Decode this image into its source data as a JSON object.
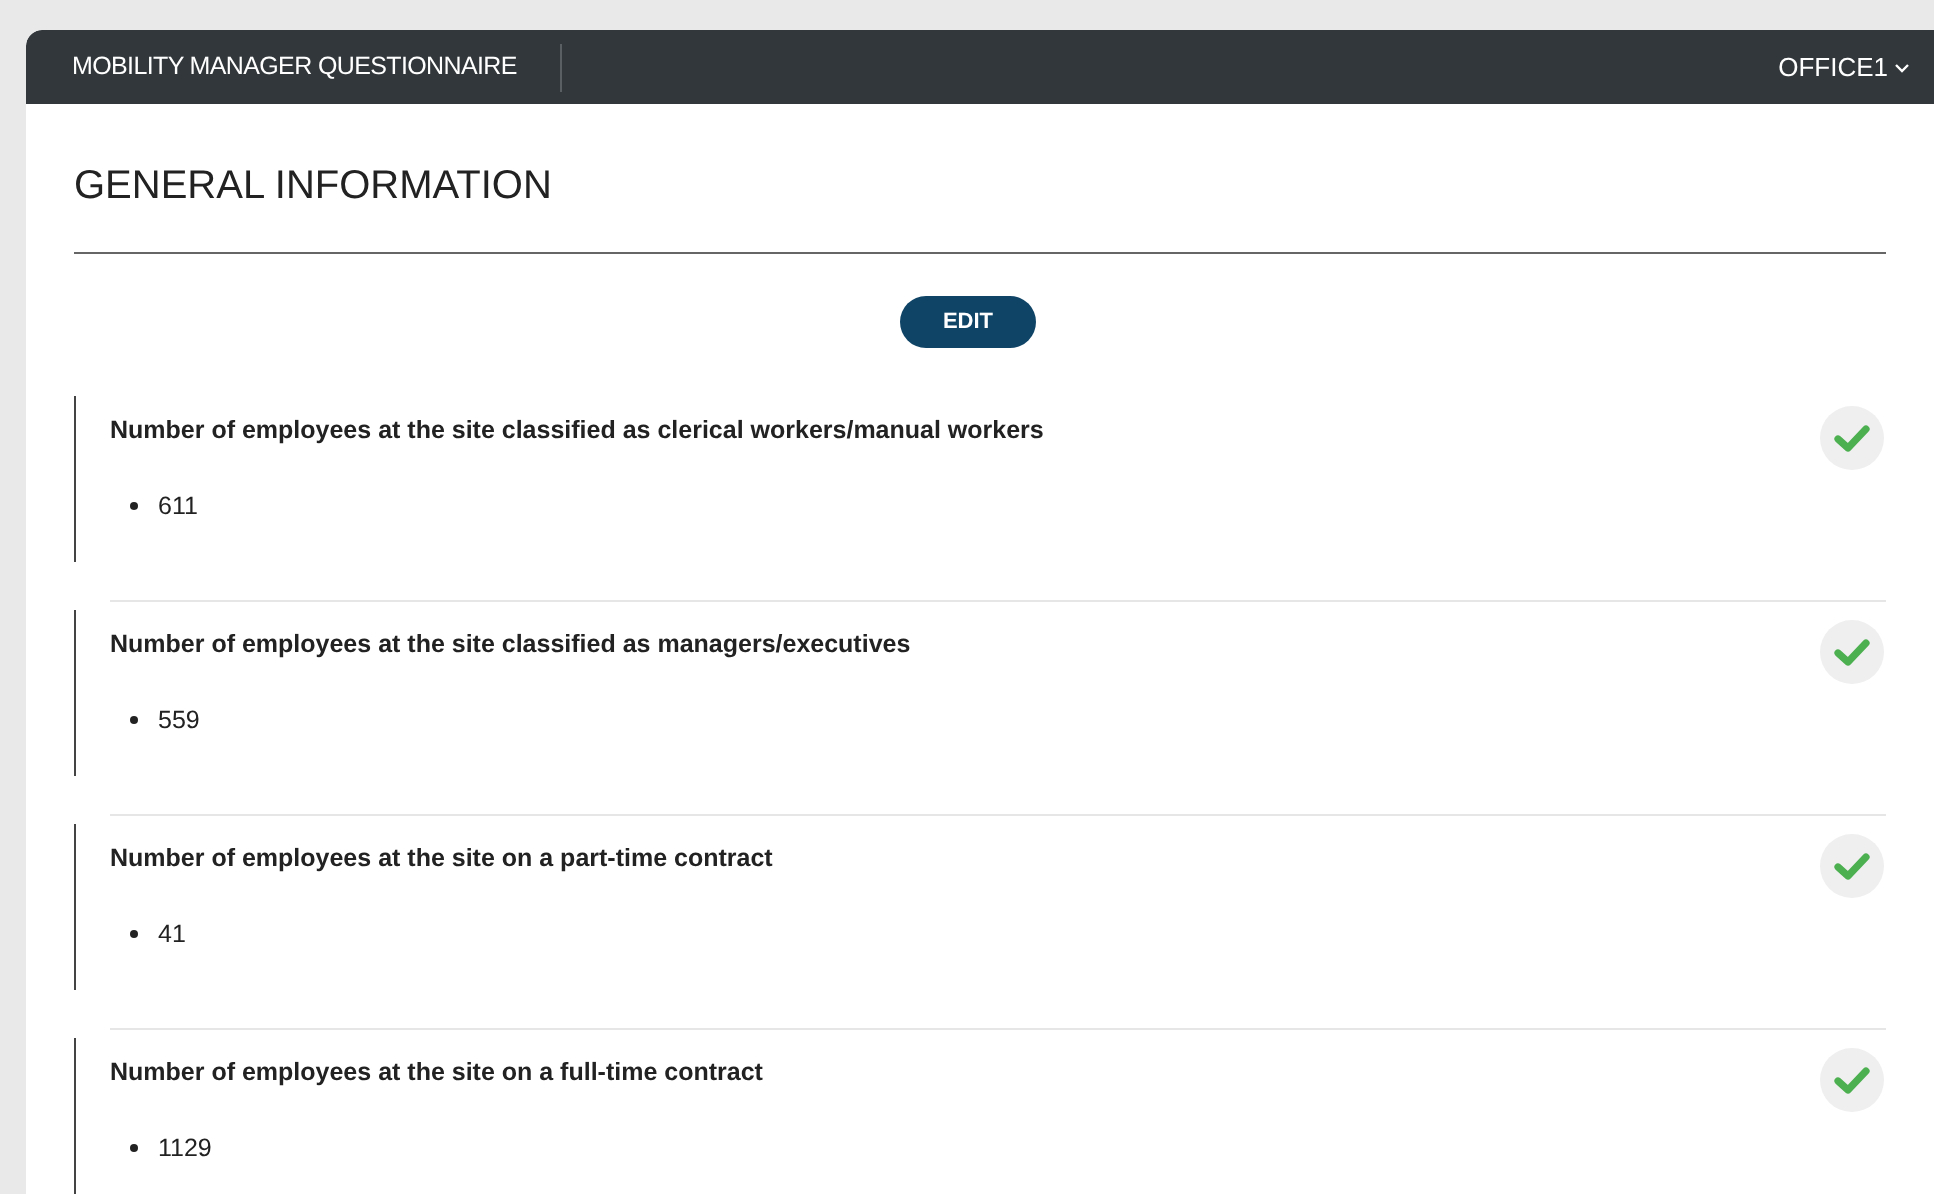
{
  "header": {
    "title": "MOBILITY MANAGER QUESTIONNAIRE",
    "office": "OFFICE1"
  },
  "section": {
    "title": "GENERAL INFORMATION",
    "edit_button": "EDIT"
  },
  "questions": [
    {
      "question": "Number of employees at the site classified as clerical workers/manual workers",
      "answer": "611",
      "completed": true
    },
    {
      "question": "Number of employees at the site classified as managers/executives",
      "answer": "559",
      "completed": true
    },
    {
      "question": "Number of employees at the site on a part-time contract",
      "answer": "41",
      "completed": true
    },
    {
      "question": "Number of employees at the site on a full-time contract",
      "answer": "1129",
      "completed": true
    }
  ]
}
